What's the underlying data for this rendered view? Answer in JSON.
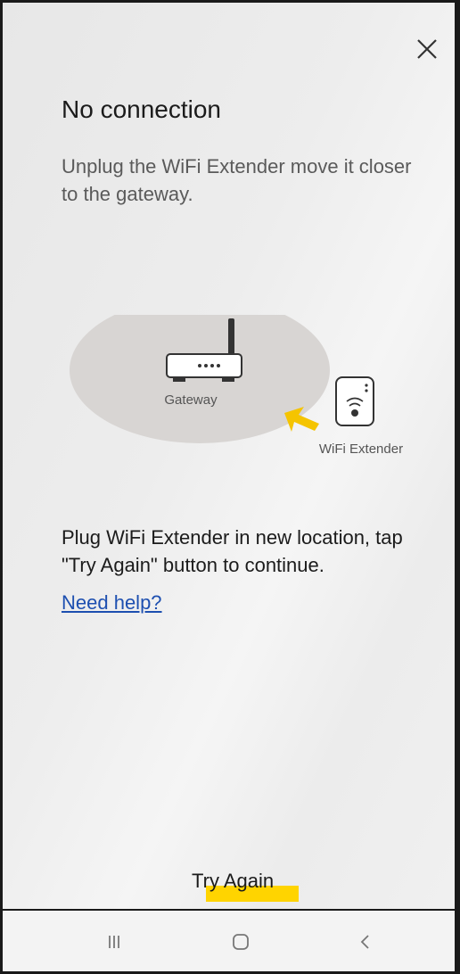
{
  "header": {
    "close_icon": "close-icon"
  },
  "content": {
    "title": "No connection",
    "subtitle": "Unplug the WiFi Extender move it closer to the gateway.",
    "gateway_label": "Gateway",
    "extender_label": "WiFi Extender",
    "instruction": "Plug WiFi Extender in new location, tap \"Try Again\" button to continue.",
    "help_link": "Need help?"
  },
  "footer": {
    "try_again_label": "Try Again"
  },
  "navbar": {
    "recents_icon": "recents-icon",
    "home_icon": "home-icon",
    "back_icon": "back-icon"
  },
  "colors": {
    "link": "#1d4fb0",
    "highlight": "#ffd400",
    "arrow": "#f5c400",
    "bubble": "#d8d5d3"
  }
}
